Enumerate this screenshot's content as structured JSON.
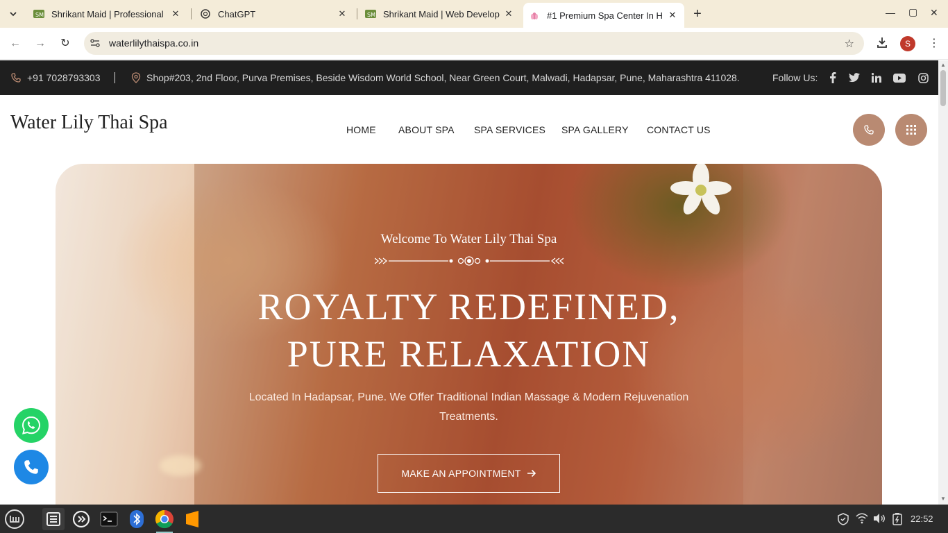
{
  "browser": {
    "tabs": [
      {
        "title": "Shrikant Maid | Professional",
        "active": false
      },
      {
        "title": "ChatGPT",
        "active": false
      },
      {
        "title": "Shrikant Maid | Web Develop",
        "active": false
      },
      {
        "title": "#1 Premium Spa Center In H",
        "active": true
      }
    ],
    "url": "waterlilythaispa.co.in",
    "profile_initial": "S"
  },
  "topbar": {
    "phone": "+91 7028793303",
    "address": "Shop#203, 2nd Floor, Purva Premises, Beside Wisdom World School, Near Green Court, Malwadi, Hadapsar, Pune, Maharashtra 411028.",
    "follow_label": "Follow Us:",
    "social": [
      "facebook-icon",
      "twitter-icon",
      "linkedin-icon",
      "youtube-icon",
      "instagram-icon"
    ]
  },
  "header": {
    "logo": "Water Lily Thai Spa",
    "menu": [
      "HOME",
      "ABOUT SPA",
      "SPA SERVICES",
      "SPA GALLERY",
      "CONTACT US"
    ]
  },
  "hero": {
    "welcome": "Welcome To Water Lily Thai Spa",
    "headline_line1": "ROYALTY REDEFINED,",
    "headline_line2": "PURE RELAXATION",
    "subtitle": "Located In Hadapsar, Pune. We Offer Traditional Indian Massage & Modern Rejuvenation Treatments.",
    "cta": "MAKE AN APPOINTMENT"
  },
  "taskbar": {
    "clock": "22:52"
  },
  "colors": {
    "accent": "#b98a72",
    "topbar_bg": "#1f1f1f",
    "whatsapp": "#25d366",
    "call": "#1e88e5"
  }
}
